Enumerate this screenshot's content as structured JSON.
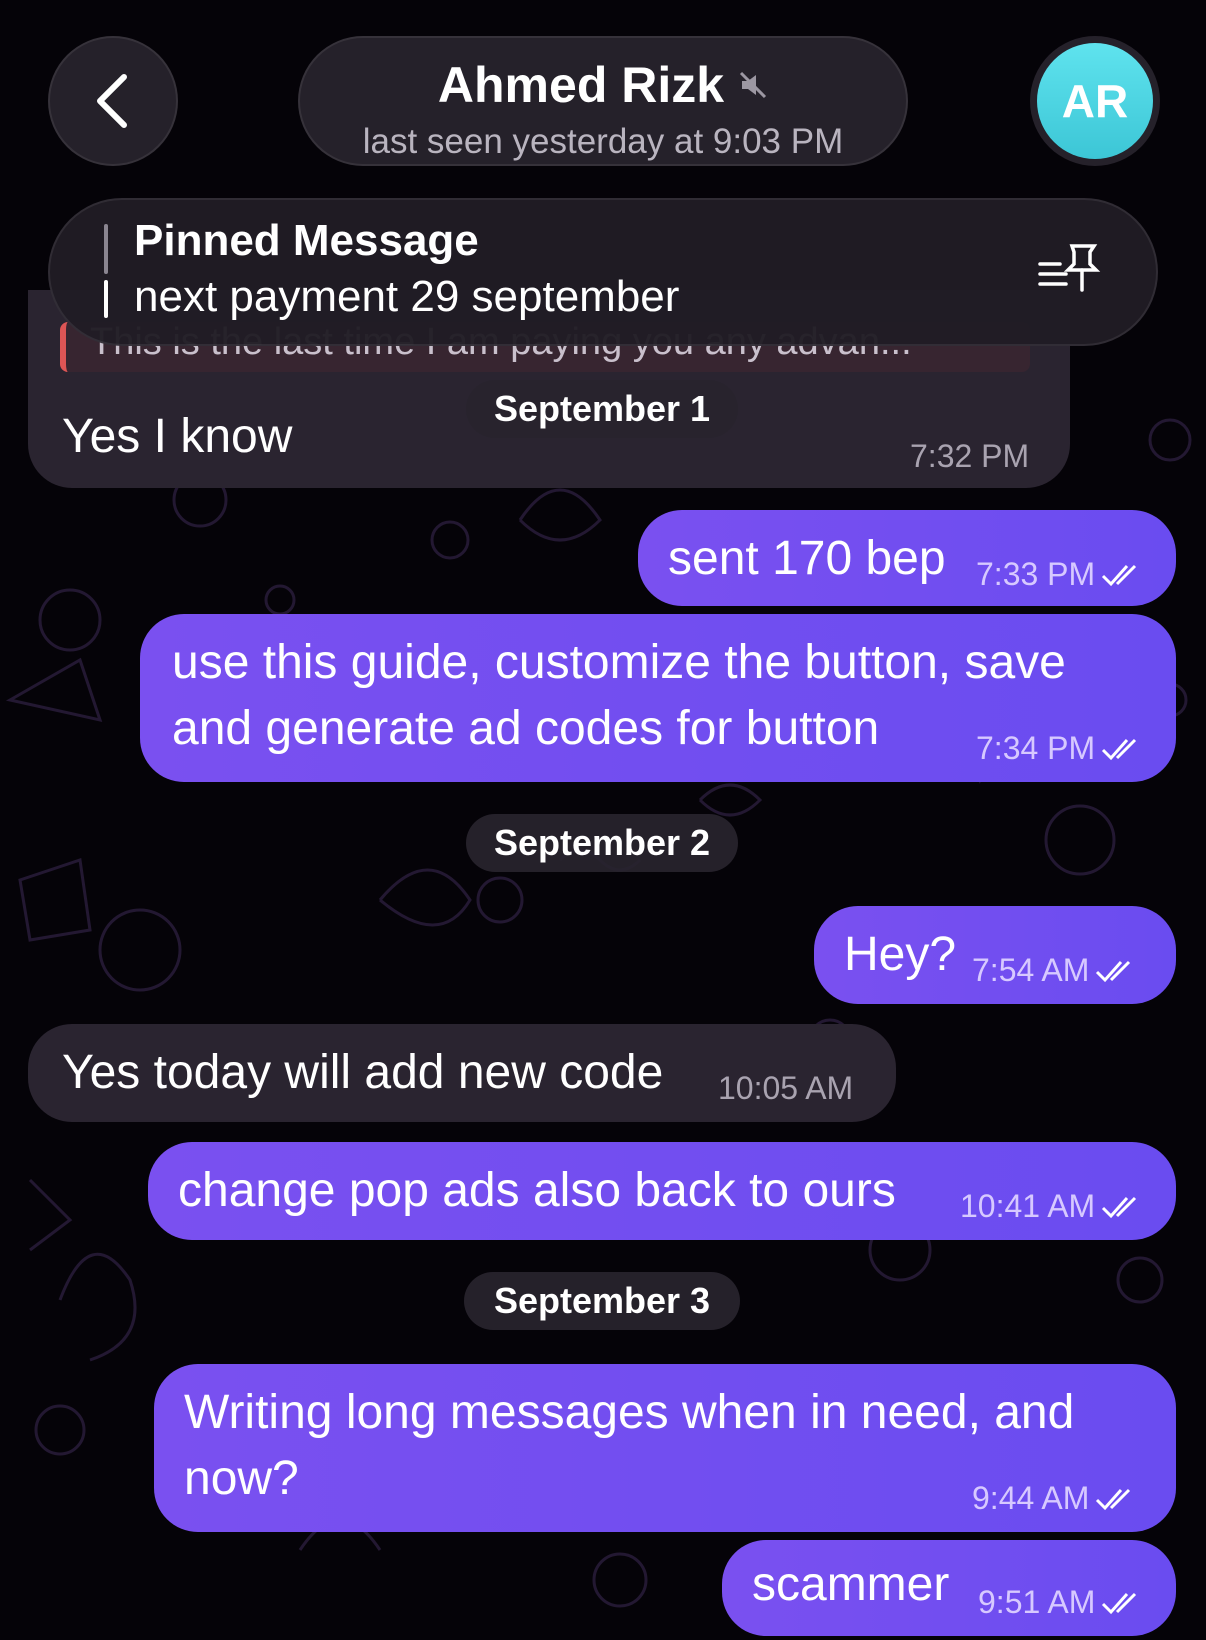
{
  "header": {
    "back_icon": "chevron-left-icon",
    "contact_name": "Ahmed Rizk",
    "muted_icon": "muted-speaker-icon",
    "status": "last seen yesterday at 9:03 PM",
    "avatar_initials": "AR",
    "avatar_color": "#4fd6e3"
  },
  "pinned": {
    "title": "Pinned Message",
    "text": "next payment 29 september",
    "icon": "pin-list-icon"
  },
  "messages": {
    "m0_quote": "This is the last time I am paying you any advan...",
    "m0_text": "Yes I know",
    "m0_time": "7:32 PM",
    "d1": "September 1",
    "m1_text": "sent 170 bep",
    "m1_time": "7:33 PM",
    "m2_line1": "use this guide, customize the button, save",
    "m2_line2": "and generate ad codes for button",
    "m2_time": "7:34 PM",
    "d2": "September 2",
    "m3_text": "Hey?",
    "m3_time": "7:54 AM",
    "m4_text": "Yes today will add new code",
    "m4_time": "10:05 AM",
    "m5_text": "change pop ads also back to ours",
    "m5_time": "10:41 AM",
    "d3": "September 3",
    "m6_line1": "Writing long messages when in need, and",
    "m6_line2": "now?",
    "m6_time": "9:44 AM",
    "m7_text": "scammer",
    "m7_time": "9:51 AM"
  },
  "colors": {
    "outgoing_bubble": "#7a50f0",
    "incoming_bubble": "#2a2430",
    "background": "#050308",
    "read_check": "#ffffff"
  }
}
